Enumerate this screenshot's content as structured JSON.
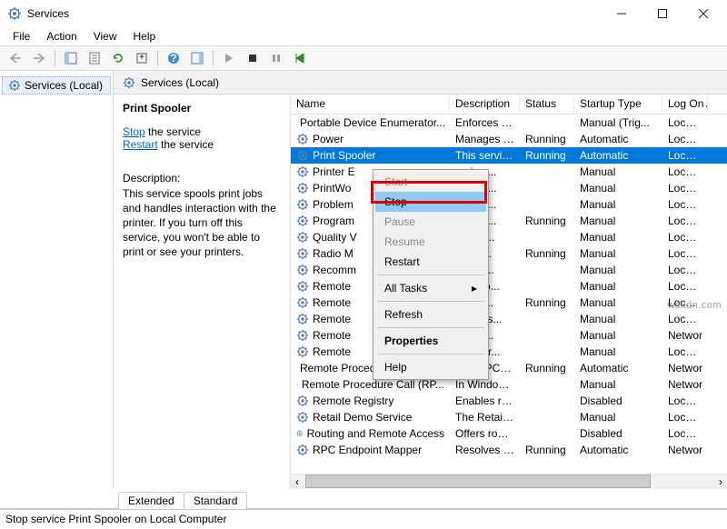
{
  "window": {
    "title": "Services"
  },
  "menu": [
    "File",
    "Action",
    "View",
    "Help"
  ],
  "nav": {
    "label": "Services (Local)"
  },
  "headerband": "Services (Local)",
  "detail": {
    "title": "Print Spooler",
    "stop_link": "Stop",
    "stop_after": " the service",
    "restart_link": "Restart",
    "restart_after": " the service",
    "desc_label": "Description:",
    "desc_body": "This service spools print jobs and handles interaction with the printer. If you turn off this service, you won't be able to print or see your printers."
  },
  "columns": {
    "c1": "Name",
    "c2": "Description",
    "c3": "Status",
    "c4": "Startup Type",
    "c5": "Log On As"
  },
  "services": [
    {
      "name": "Portable Device Enumerator...",
      "desc": "Enforces gr...",
      "status": "",
      "startup": "Manual (Trig...",
      "logon": "Local Sy"
    },
    {
      "name": "Power",
      "desc": "Manages p...",
      "status": "Running",
      "startup": "Automatic",
      "logon": "Local Sy"
    },
    {
      "name": "Print Spooler",
      "desc": "This service ...",
      "status": "Running",
      "startup": "Automatic",
      "logon": "Local Sy",
      "selected": true
    },
    {
      "name": "Printer E",
      "desc": "ervice ...",
      "status": "",
      "startup": "Manual",
      "logon": "Local Sy"
    },
    {
      "name": "PrintWo",
      "desc": "des su...",
      "status": "",
      "startup": "Manual",
      "logon": "Local Sy"
    },
    {
      "name": "Problem",
      "desc": "ervice ...",
      "status": "",
      "startup": "Manual",
      "logon": "Local Sy"
    },
    {
      "name": "Program",
      "desc": "ervice ...",
      "status": "Running",
      "startup": "Manual",
      "logon": "Local Sy"
    },
    {
      "name": "Quality V",
      "desc": "ty Win...",
      "status": "",
      "startup": "Manual",
      "logon": "Local Sy"
    },
    {
      "name": "Radio M",
      "desc": "Mana...",
      "status": "Running",
      "startup": "Manual",
      "logon": "Local Sy"
    },
    {
      "name": "Recomm",
      "desc": "es aut...",
      "status": "",
      "startup": "Manual",
      "logon": "Local Sy"
    },
    {
      "name": "Remote",
      "desc": "es a co...",
      "status": "",
      "startup": "Manual",
      "logon": "Local Sy"
    },
    {
      "name": "Remote",
      "desc": "ges di...",
      "status": "Running",
      "startup": "Manual",
      "logon": "Local Sy"
    },
    {
      "name": "Remote",
      "desc": "ote Des...",
      "status": "",
      "startup": "Manual",
      "logon": "Local Sy"
    },
    {
      "name": "Remote",
      "desc": "s user...",
      "status": "",
      "startup": "Manual",
      "logon": "Networ"
    },
    {
      "name": "Remote",
      "desc": "es the r...",
      "status": "",
      "startup": "Manual",
      "logon": "Local Sy"
    },
    {
      "name": "Remote Procedure Call (RPC)",
      "desc": "The RPCSS s...",
      "status": "Running",
      "startup": "Automatic",
      "logon": "Networ"
    },
    {
      "name": "Remote Procedure Call (RP...",
      "desc": "In Windows...",
      "status": "",
      "startup": "Manual",
      "logon": "Networ"
    },
    {
      "name": "Remote Registry",
      "desc": "Enables rem...",
      "status": "",
      "startup": "Disabled",
      "logon": "Local Sy"
    },
    {
      "name": "Retail Demo Service",
      "desc": "The Retail D...",
      "status": "",
      "startup": "Manual",
      "logon": "Local Sy"
    },
    {
      "name": "Routing and Remote Access",
      "desc": "Offers routi...",
      "status": "",
      "startup": "Disabled",
      "logon": "Local Sy"
    },
    {
      "name": "RPC Endpoint Mapper",
      "desc": "Resolves RP...",
      "status": "Running",
      "startup": "Automatic",
      "logon": "Networ"
    }
  ],
  "context_menu": [
    {
      "label": "Start",
      "disabled": true
    },
    {
      "label": "Stop",
      "selected": true
    },
    {
      "label": "Pause",
      "disabled": true
    },
    {
      "label": "Resume",
      "disabled": true
    },
    {
      "label": "Restart"
    },
    {
      "sep": true
    },
    {
      "label": "All Tasks",
      "submenu": true
    },
    {
      "sep": true
    },
    {
      "label": "Refresh"
    },
    {
      "sep": true
    },
    {
      "label": "Properties",
      "bold": true
    },
    {
      "sep": true
    },
    {
      "label": "Help"
    }
  ],
  "tabs": [
    "Extended",
    "Standard"
  ],
  "status_bar": "Stop service Print Spooler on Local Computer",
  "watermark": "wsxdn.com"
}
